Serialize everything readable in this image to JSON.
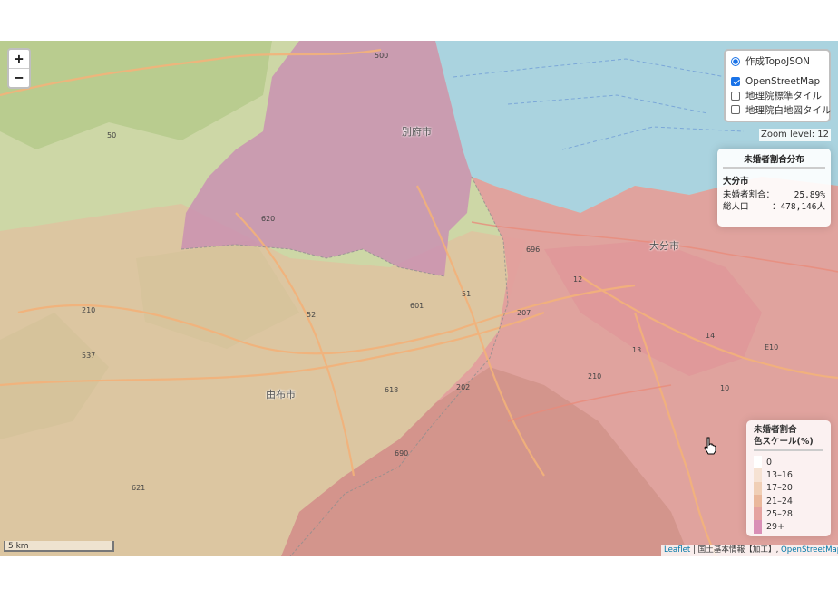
{
  "zoom_controls": {
    "in_label": "+",
    "out_label": "−"
  },
  "layers": {
    "overlay_label": "作成TopoJSON",
    "base": [
      {
        "label": "OpenStreetMap",
        "checked": true
      },
      {
        "label": "地理院標準タイル",
        "checked": false
      },
      {
        "label": "地理院白地図タイル",
        "checked": false
      }
    ]
  },
  "zoom_level_text": "Zoom level: 12",
  "info_panel": {
    "title": "未婚者割合分布",
    "city": "大分市",
    "rate_label": "未婚者割合：",
    "rate_value": "25.89%",
    "pop_label": "総人口",
    "pop_value": "：478,146人"
  },
  "legend": {
    "title_line1": "未婚者割合",
    "title_line2": "色スケール(%)",
    "items": [
      {
        "label": "0",
        "color": "#ffffff"
      },
      {
        "label": "13–16",
        "color": "#f6e2d3"
      },
      {
        "label": "17–20",
        "color": "#f0cfb6"
      },
      {
        "label": "21–24",
        "color": "#eab89c"
      },
      {
        "label": "25–28",
        "color": "#e5a3a0"
      },
      {
        "label": "29+",
        "color": "#d98fb6"
      }
    ]
  },
  "scale_bar": "5 km",
  "attribution": {
    "leaflet": "Leaflet",
    "gsi": "国土基本情報【加工】,",
    "osm": "OpenStreetMap",
    "sep": "|"
  },
  "map_labels": {
    "beppu": "別府市",
    "oita": "大分市",
    "yufu": "由布市"
  },
  "road_labels": [
    "500",
    "50",
    "620",
    "210",
    "52",
    "601",
    "51",
    "207",
    "537",
    "618",
    "202",
    "690",
    "621",
    "696",
    "12",
    "13",
    "14",
    "E10",
    "10",
    "210"
  ],
  "colors": {
    "sea": "#aad3df",
    "oita_fill": "#e5a3a0",
    "beppu_fill": "#d98fb6",
    "yufu_fill": "#eab89c",
    "land": "#c9d6a0"
  }
}
